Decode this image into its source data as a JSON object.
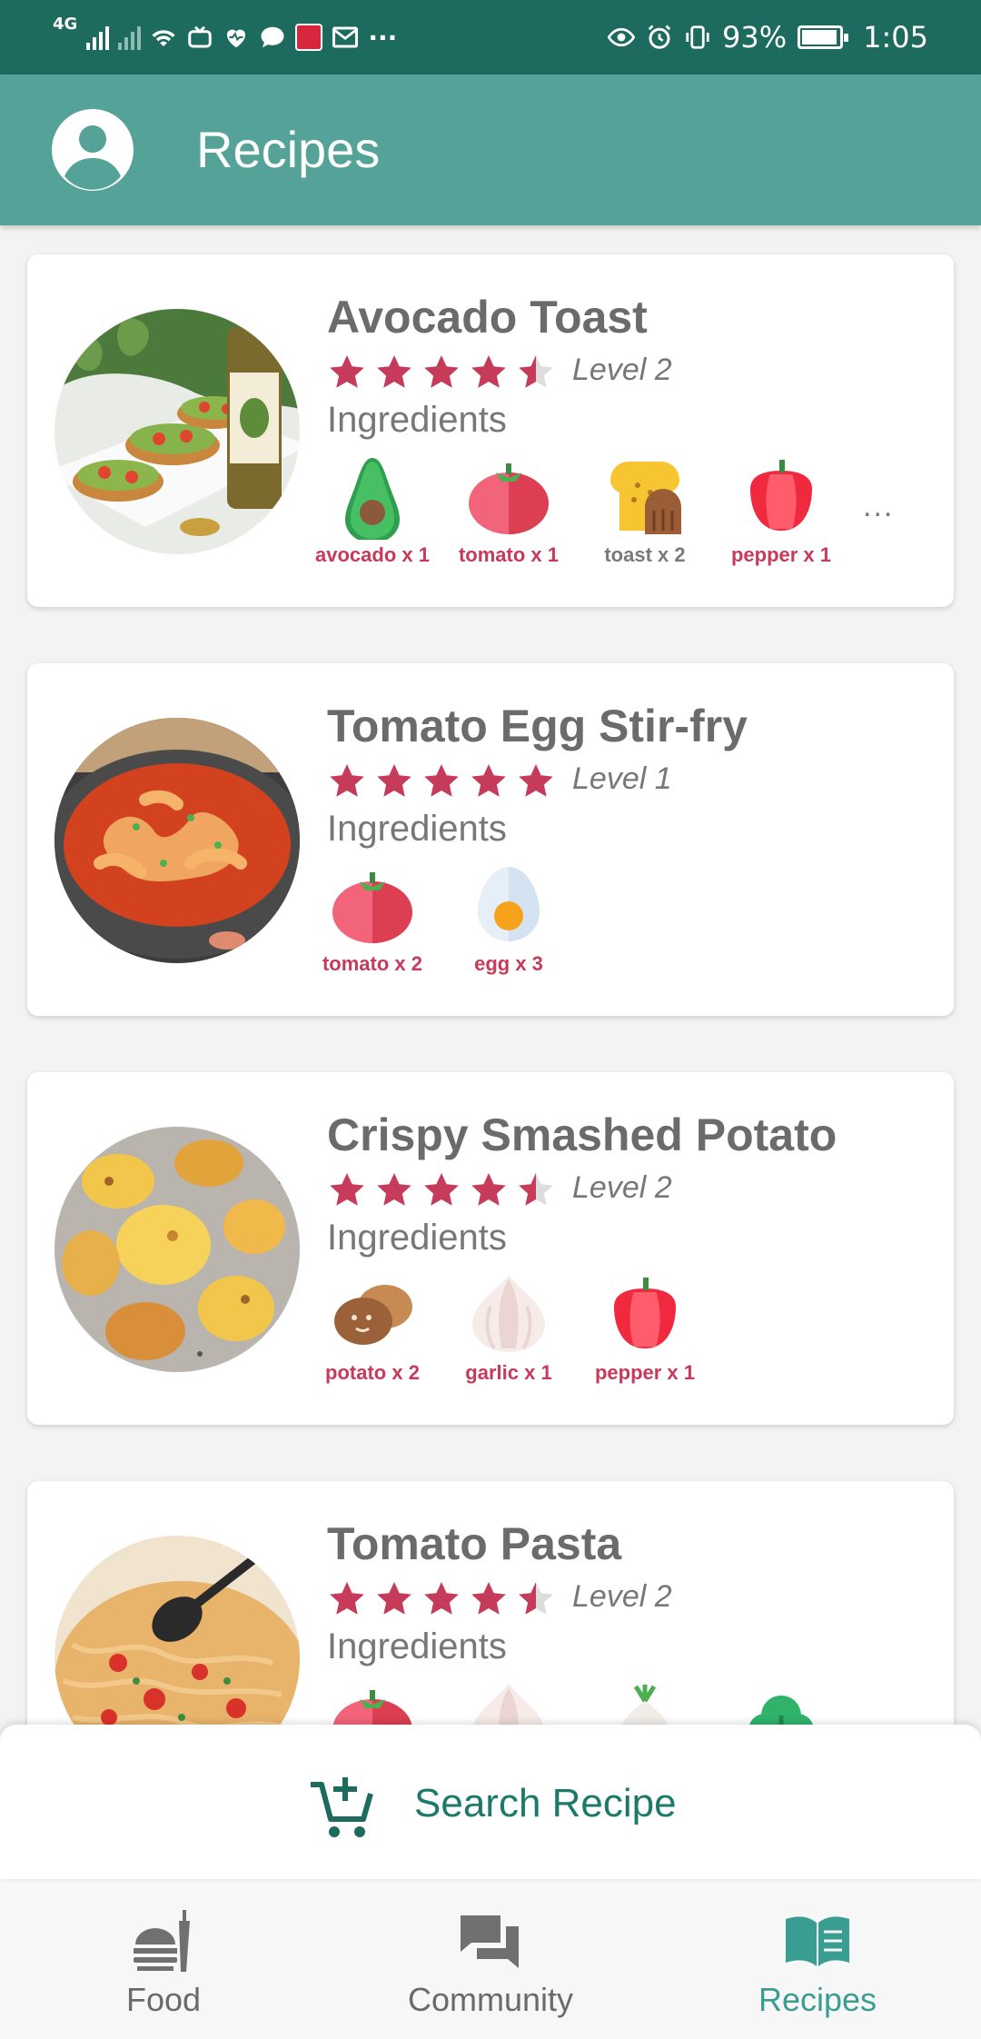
{
  "status_bar": {
    "network": "4G",
    "battery": "93%",
    "time": "1:05",
    "icons": [
      "signal-icon",
      "wifi-icon",
      "tv-icon",
      "health-icon",
      "chat-icon",
      "app-icon",
      "mail-icon",
      "more-icon",
      "eye-icon",
      "alarm-icon",
      "vibrate-icon",
      "battery-icon"
    ]
  },
  "app_bar": {
    "title": "Recipes",
    "avatar_icon": "account-icon"
  },
  "recipes": [
    {
      "title": "Avocado Toast",
      "rating": 4.5,
      "level": "Level 2",
      "ingredients_label": "Ingredients",
      "ingredients": [
        {
          "icon": "avocado-icon",
          "label": "avocado x 1",
          "highlight": true
        },
        {
          "icon": "tomato-icon",
          "label": "tomato x 1",
          "highlight": true
        },
        {
          "icon": "toast-icon",
          "label": "toast x 2",
          "highlight": false
        },
        {
          "icon": "pepper-icon",
          "label": "pepper x 1",
          "highlight": true
        }
      ],
      "more": "..."
    },
    {
      "title": "Tomato Egg Stir-fry",
      "rating": 5,
      "level": "Level 1",
      "ingredients_label": "Ingredients",
      "ingredients": [
        {
          "icon": "tomato-icon",
          "label": "tomato x 2",
          "highlight": true
        },
        {
          "icon": "egg-icon",
          "label": "egg x 3",
          "highlight": true
        }
      ]
    },
    {
      "title": "Crispy Smashed Potato",
      "rating": 4.5,
      "level": "Level 2",
      "ingredients_label": "Ingredients",
      "ingredients": [
        {
          "icon": "potato-icon",
          "label": "potato x 2",
          "highlight": true
        },
        {
          "icon": "garlic-icon",
          "label": "garlic x 1",
          "highlight": true
        },
        {
          "icon": "pepper-icon",
          "label": "pepper x 1",
          "highlight": true
        }
      ]
    },
    {
      "title": "Tomato Pasta",
      "rating": 4.5,
      "level": "Level 2",
      "ingredients_label": "Ingredients",
      "ingredients": [
        {
          "icon": "tomato-icon",
          "label": "",
          "highlight": true
        },
        {
          "icon": "garlic-icon",
          "label": "",
          "highlight": true
        },
        {
          "icon": "onion-icon",
          "label": "",
          "highlight": true
        },
        {
          "icon": "herb-icon",
          "label": "",
          "highlight": true
        }
      ]
    }
  ],
  "search_button": {
    "label": "Search Recipe",
    "icon": "add-cart-icon"
  },
  "bottom_nav": [
    {
      "label": "Food",
      "icon": "food-icon",
      "active": false
    },
    {
      "label": "Community",
      "icon": "forum-icon",
      "active": false
    },
    {
      "label": "Recipes",
      "icon": "book-icon",
      "active": true
    }
  ],
  "colors": {
    "status_bar": "#1d6a5e",
    "app_bar": "#55a398",
    "accent": "#3a9d92",
    "star": "#c63b5a",
    "ingredient_label": "#c63b5a"
  }
}
